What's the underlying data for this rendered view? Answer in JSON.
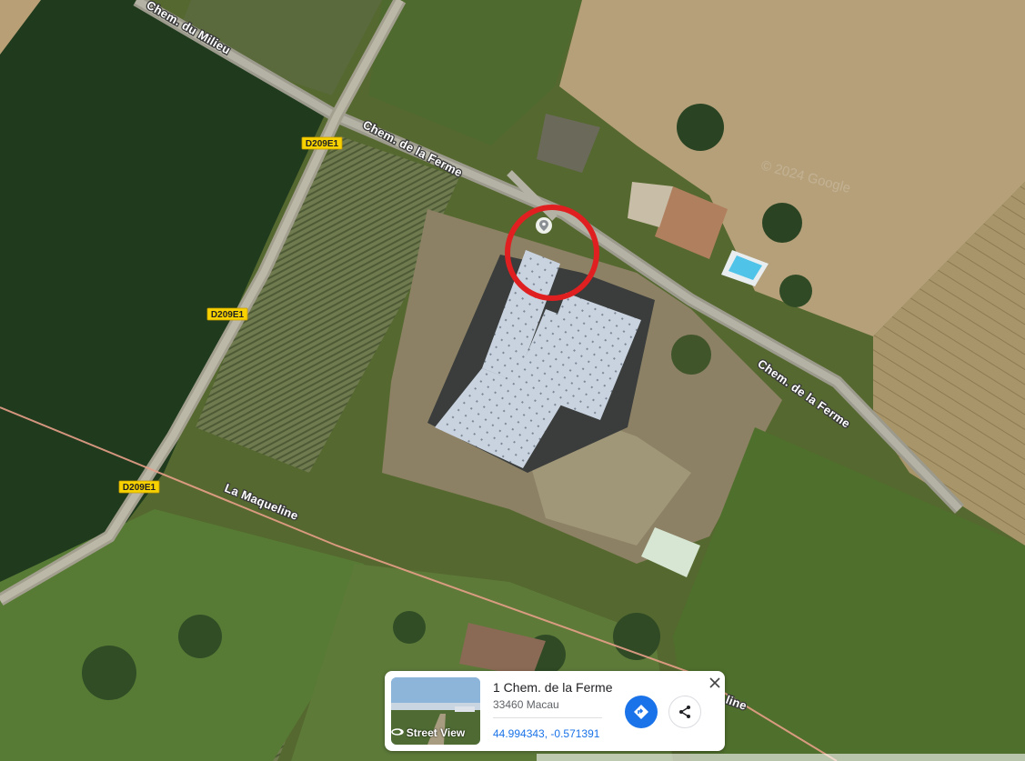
{
  "map": {
    "roads": {
      "chem_du_milieu": "Chem. du Milieu",
      "chem_de_la_ferme_1": "Chem. de la Ferme",
      "chem_de_la_ferme_2": "Chem. de la Ferme",
      "la_maqueline": "La Maqueline",
      "la_maqueline_partial": "line"
    },
    "shields": [
      "D209E1",
      "D209E1",
      "D209E1"
    ],
    "watermark": "© 2024 Google",
    "highlight_color": "#e02020"
  },
  "place_card": {
    "title": "1 Chem. de la Ferme",
    "subtitle": "33460 Macau",
    "coordinates": "44.994343, -0.571391",
    "street_view_label": "Street View",
    "directions_icon": "directions-icon",
    "share_icon": "share-icon",
    "close_icon": "close-icon",
    "accent_color": "#1a73e8"
  }
}
